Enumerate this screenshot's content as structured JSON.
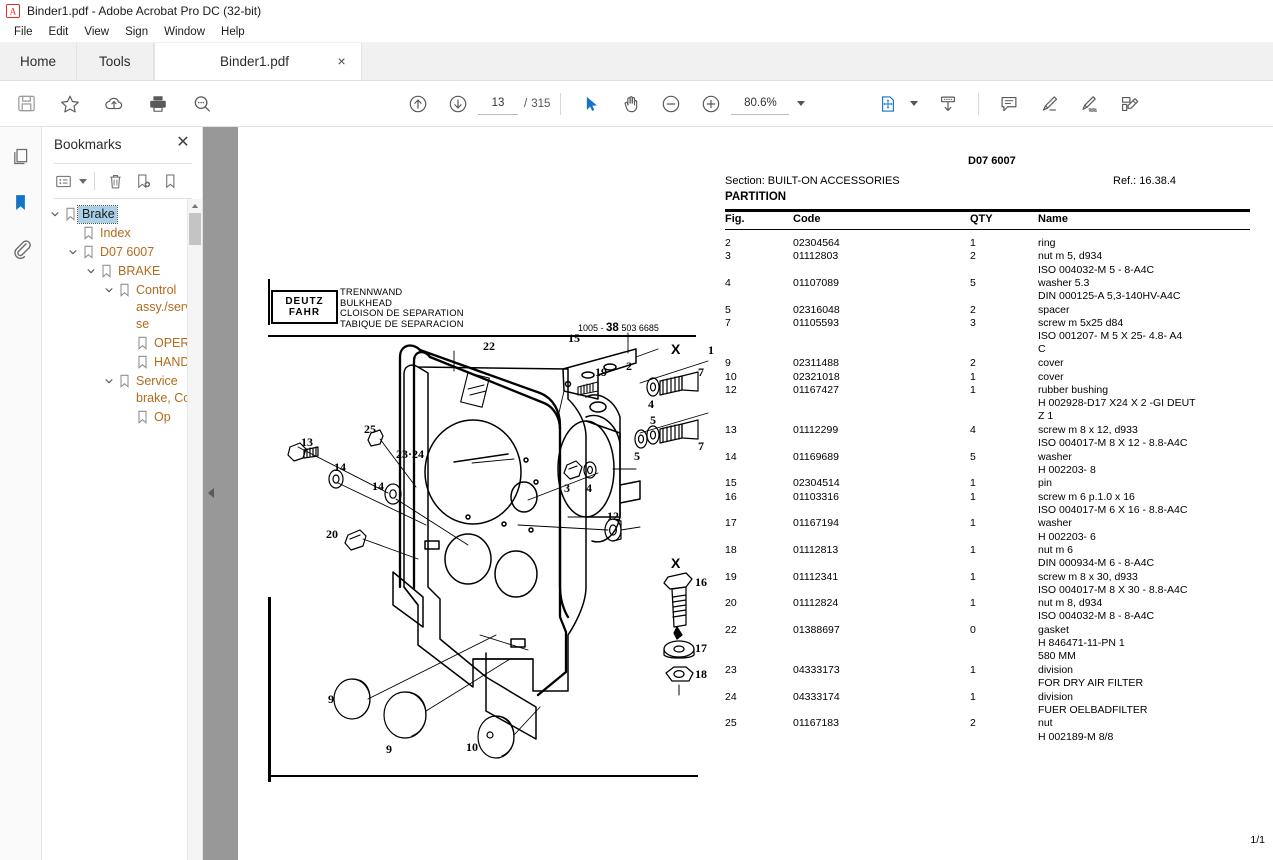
{
  "window": {
    "title": "Binder1.pdf - Adobe Acrobat Pro DC (32-bit)",
    "app_icon": "acrobat-icon"
  },
  "menubar": {
    "items": [
      "File",
      "Edit",
      "View",
      "Sign",
      "Window",
      "Help"
    ]
  },
  "tabs": {
    "home": "Home",
    "tools": "Tools",
    "document": "Binder1.pdf",
    "close": "×"
  },
  "toolbar": {
    "left_icons": [
      "save-icon",
      "star-icon",
      "cloud-upload-icon",
      "print-icon",
      "search-icon"
    ],
    "page_value": "13",
    "page_separator": "/",
    "page_total": "315",
    "zoom_value": "80.6%",
    "right_icons": [
      "select-tool-icon",
      "hand-tool-icon",
      "zoom-out-icon",
      "zoom-in-icon",
      "fit-page-icon",
      "scroll-mode-icon",
      "comment-icon",
      "highlight-icon",
      "sign-icon",
      "fill-sign-icon"
    ]
  },
  "rail": {
    "items": [
      "page-thumbnails-icon",
      "bookmarks-icon",
      "attachments-icon"
    ],
    "active": "bookmarks-icon"
  },
  "bookmarks_panel": {
    "title": "Bookmarks",
    "close": "✕",
    "tools": [
      "options-list-icon",
      "delete-icon",
      "new-bookmark-icon",
      "edit-bookmark-icon"
    ],
    "items": [
      {
        "label": "Brake",
        "depth": 0,
        "expanded": true,
        "selected": true
      },
      {
        "label": "Index",
        "depth": 1,
        "expanded": null,
        "selected": false
      },
      {
        "label": "D07 6007",
        "depth": 1,
        "expanded": true,
        "selected": false
      },
      {
        "label": "BRAKE",
        "depth": 2,
        "expanded": true,
        "selected": false
      },
      {
        "label": "Control assy./servise",
        "depth": 3,
        "expanded": true,
        "selected": false
      },
      {
        "label": "OPERA",
        "depth": 4,
        "expanded": null,
        "selected": false
      },
      {
        "label": "HANDB",
        "depth": 4,
        "expanded": null,
        "selected": false
      },
      {
        "label": "Service brake, Con",
        "depth": 3,
        "expanded": true,
        "selected": false
      },
      {
        "label": "Op",
        "depth": 4,
        "expanded": null,
        "selected": false
      }
    ]
  },
  "document": {
    "page_indicator": "1/1",
    "header": {
      "doc_number": "D07 6007",
      "section": "Section: BUILT-ON ACCESSORIES",
      "ref": "Ref.: 16.38.4",
      "partition": "PARTITION"
    },
    "table": {
      "columns": [
        "Fig.",
        "Code",
        "QTY",
        "Name"
      ],
      "rows": [
        {
          "fig": "2",
          "code": "02304564",
          "qty": "1",
          "name": "ring",
          "sub": []
        },
        {
          "fig": "3",
          "code": "01112803",
          "qty": "2",
          "name": "nut m 5, d934",
          "sub": [
            "ISO 004032-M 5 - 8-A4C"
          ]
        },
        {
          "fig": "4",
          "code": "01107089",
          "qty": "5",
          "name": "washer 5.3",
          "sub": [
            "DIN 000125-A 5,3-140HV-A4C"
          ]
        },
        {
          "fig": "5",
          "code": "02316048",
          "qty": "2",
          "name": "spacer",
          "sub": []
        },
        {
          "fig": "7",
          "code": "01105593",
          "qty": "3",
          "name": "screw m 5x25 d84",
          "sub": [
            "ISO 001207- M 5 X 25- 4.8- A4",
            "C"
          ]
        },
        {
          "fig": "9",
          "code": "02311488",
          "qty": "2",
          "name": "cover",
          "sub": []
        },
        {
          "fig": "10",
          "code": "02321018",
          "qty": "1",
          "name": "cover",
          "sub": []
        },
        {
          "fig": "12",
          "code": "01167427",
          "qty": "1",
          "name": "rubber bushing",
          "sub": [
            "H 002928-D17 X24 X 2 -GI DEUT",
            "Z 1"
          ]
        },
        {
          "fig": "13",
          "code": "01112299",
          "qty": "4",
          "name": "screw m 8 x 12, d933",
          "sub": [
            "ISO 004017-M 8 X 12 - 8.8-A4C"
          ]
        },
        {
          "fig": "14",
          "code": "01169689",
          "qty": "5",
          "name": "washer",
          "sub": [
            "H 002203- 8"
          ]
        },
        {
          "fig": "15",
          "code": "02304514",
          "qty": "1",
          "name": "pin",
          "sub": []
        },
        {
          "fig": "16",
          "code": "01103316",
          "qty": "1",
          "name": "screw m 6 p.1.0 x 16",
          "sub": [
            "ISO 004017-M 6 X 16 - 8.8-A4C"
          ]
        },
        {
          "fig": "17",
          "code": "01167194",
          "qty": "1",
          "name": "washer",
          "sub": [
            "H 002203- 6"
          ]
        },
        {
          "fig": "18",
          "code": "01112813",
          "qty": "1",
          "name": "nut m 6",
          "sub": [
            "DIN 000934-M 6 - 8-A4C"
          ]
        },
        {
          "fig": "19",
          "code": "01112341",
          "qty": "1",
          "name": "screw m 8 x 30, d933",
          "sub": [
            "ISO 004017-M 8 X 30 - 8.8-A4C"
          ]
        },
        {
          "fig": "20",
          "code": "01112824",
          "qty": "1",
          "name": "nut m 8, d934",
          "sub": [
            "ISO 004032-M 8 - 8-A4C"
          ]
        },
        {
          "fig": "22",
          "code": "01388697",
          "qty": "0",
          "name": "gasket",
          "sub": [
            "H 846471-11-PN 1",
            "580 MM"
          ]
        },
        {
          "fig": "23",
          "code": "04333173",
          "qty": "1",
          "name": "division",
          "sub": [
            "FOR DRY AIR FILTER"
          ]
        },
        {
          "fig": "24",
          "code": "04333174",
          "qty": "1",
          "name": "division",
          "sub": [
            "FUER OELBADFILTER"
          ]
        },
        {
          "fig": "25",
          "code": "01167183",
          "qty": "2",
          "name": "nut",
          "sub": [
            "H 002189-M 8/8"
          ]
        }
      ]
    },
    "diagram": {
      "brand_line1": "DEUTZ",
      "brand_line2": "FAHR",
      "titles": [
        "TRENNWAND",
        "BULKHEAD",
        "CLOISON DE SEPARATION",
        "TABIQUE DE SEPARACION"
      ],
      "drawing_code_prefix": "1005 - ",
      "drawing_code_bold": "38",
      "drawing_code_suffix": " 503 6685",
      "callouts": [
        "1",
        "2",
        "3",
        "4",
        "4",
        "5",
        "5",
        "7",
        "7",
        "9",
        "9",
        "10",
        "12",
        "13",
        "14",
        "14",
        "15",
        "16",
        "17",
        "18",
        "19",
        "20",
        "22",
        "23·24",
        "25",
        "X",
        "X"
      ]
    }
  },
  "colors": {
    "accent": "#1473c6",
    "bookmark_text": "#b36b1c",
    "selection": "#a8d0e8",
    "backdrop": "#989898",
    "chrome": "#f1f1f1"
  }
}
